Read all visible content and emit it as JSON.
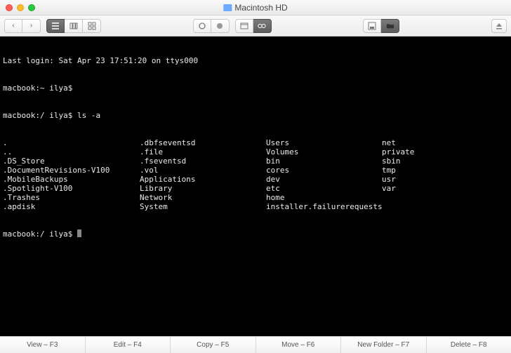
{
  "window": {
    "title": "Macintosh HD"
  },
  "toolbar": {
    "back": "‹",
    "forward": "›"
  },
  "terminal": {
    "last_login": "Last login: Sat Apr 23 17:51:20 on ttys000",
    "prompt_home": "macbook:~ ilya$",
    "prompt_root": "macbook:/ ilya$",
    "cmd_ls": "ls -a",
    "ls_columns": [
      [
        ".",
        "..",
        ".DS_Store",
        ".DocumentRevisions-V100",
        ".MobileBackups",
        ".Spotlight-V100",
        ".Trashes",
        ".apdisk"
      ],
      [
        ".dbfseventsd",
        ".file",
        ".fseventsd",
        ".vol",
        "Applications",
        "Library",
        "Network",
        "System"
      ],
      [
        "Users",
        "Volumes",
        "bin",
        "cores",
        "dev",
        "etc",
        "home",
        "installer.failurerequests"
      ],
      [
        "net",
        "private",
        "sbin",
        "tmp",
        "usr",
        "var"
      ]
    ]
  },
  "footer": {
    "buttons": [
      "View – F3",
      "Edit – F4",
      "Copy – F5",
      "Move – F6",
      "New Folder – F7",
      "Delete – F8"
    ]
  }
}
